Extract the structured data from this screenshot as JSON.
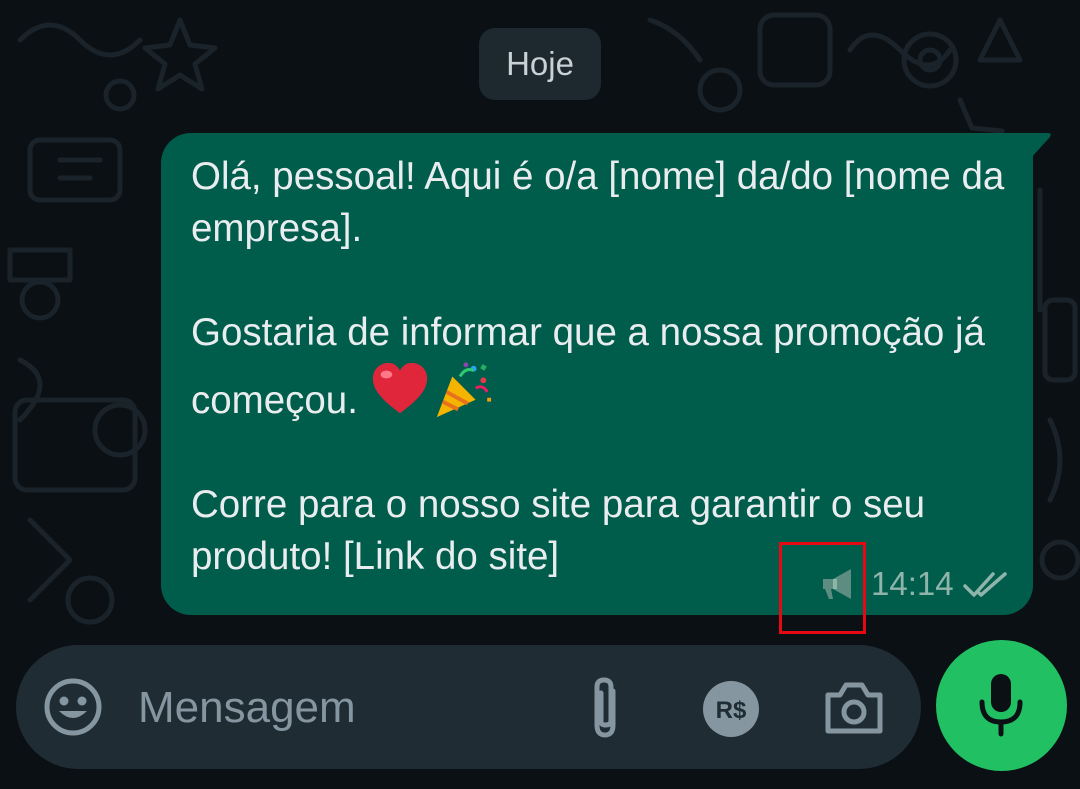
{
  "chat": {
    "date_separator": "Hoje",
    "message": {
      "text": "Olá, pessoal! Aqui é o/a [nome] da/do [nome da empresa].\n\nGostaria de informar que a nossa promoção já começou.",
      "text_end": "Corre para o nosso site para garantir o seu produto! [Link do site]",
      "emojis": [
        "heart-emoji",
        "party-popper-emoji"
      ],
      "time": "14:14",
      "status_icon": "double-check-icon",
      "broadcast_icon": "megaphone-icon"
    }
  },
  "composer": {
    "placeholder": "Mensagem",
    "icons": [
      "emoji-icon",
      "attach-icon",
      "payment-icon",
      "camera-icon"
    ],
    "send_icon": "mic-icon"
  },
  "colors": {
    "background": "#0b1014",
    "bubble": "#005c4b",
    "composer": "#1f2c34",
    "mic_button": "#21c063",
    "highlight": "#e50914"
  }
}
